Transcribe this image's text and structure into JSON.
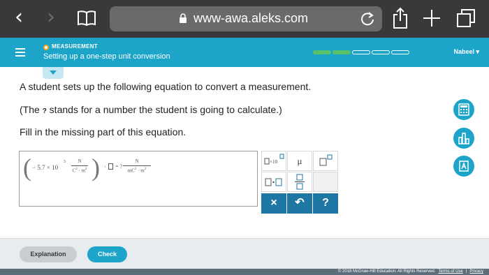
{
  "browser": {
    "back_glyph": "‹",
    "forward_glyph": "›",
    "url": "www-awa.aleks.com"
  },
  "header": {
    "topic_label": "MEASUREMENT",
    "topic_title": "Setting up a one-step unit conversion",
    "progress": {
      "filled": 2,
      "total": 5
    },
    "user_name": "Nabeel ▾"
  },
  "problem": {
    "line1": "A student sets up the following equation to convert a measurement.",
    "line2_before": "(The ",
    "line2_q": "?",
    "line2_after": " stands for a number the student is going to calculate.)",
    "line3": "Fill in the missing part of this equation."
  },
  "equation": {
    "coefficient": "− 5.7 × 10",
    "exponent": "5",
    "frac1_num": "N",
    "frac1_den_a": "C",
    "frac1_den_a_sup": "2",
    "frac1_den_b": "· m",
    "frac1_den_b_sup": "2",
    "dot": "·",
    "equals_q": "= ?",
    "frac2_num": "N",
    "frac2_den_a": "mC",
    "frac2_den_a_sup": "2",
    "frac2_den_b": "· m",
    "frac2_den_b_sup": "2"
  },
  "keypad": {
    "sci_label": "×10",
    "mu_label": "μ",
    "clear_label": "×",
    "undo_label": "↶",
    "help_label": "?"
  },
  "buttons": {
    "explanation": "Explanation",
    "check": "Check"
  },
  "footer": {
    "copyright": "© 2018 McGraw-Hill Education. All Rights Reserved.",
    "terms": "Terms of Use",
    "separator": "|",
    "privacy": "Privacy"
  },
  "colors": {
    "accent": "#1ca5c9",
    "progress_fill": "#58c26b",
    "keypad_action": "#1e77a3"
  },
  "icons": [
    "back-icon",
    "forward-icon",
    "bookmarks-icon",
    "lock-icon",
    "reload-icon",
    "share-icon",
    "new-tab-icon",
    "tabs-icon",
    "menu-icon",
    "calculator-icon",
    "chart-icon",
    "periodic-table-icon"
  ]
}
